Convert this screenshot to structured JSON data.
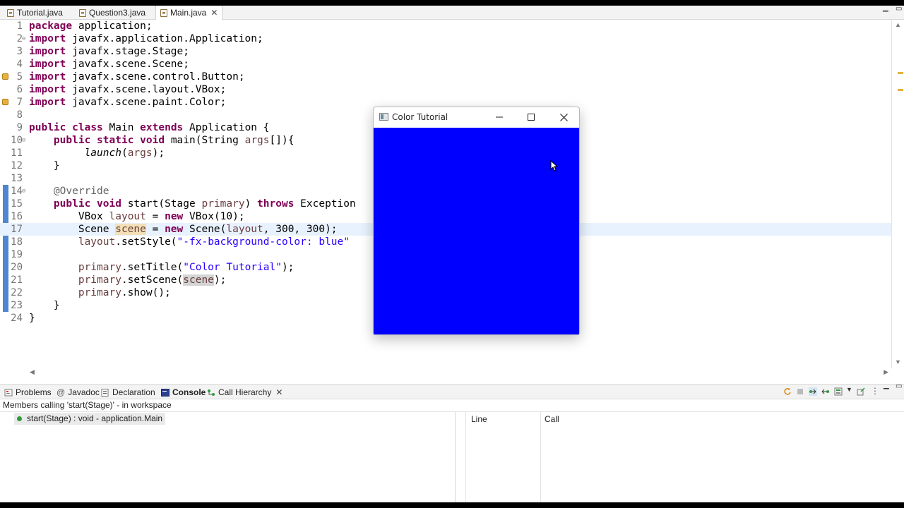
{
  "tabs": [
    {
      "label": "Tutorial.java",
      "active": false
    },
    {
      "label": "Question3.java",
      "active": false
    },
    {
      "label": "Main.java",
      "active": true
    }
  ],
  "editor": {
    "lines": [
      {
        "n": "1",
        "segs": [
          [
            "kw",
            "package"
          ],
          [
            "t",
            " application;"
          ]
        ]
      },
      {
        "n": "2",
        "fold": "⊖",
        "segs": [
          [
            "kw",
            "import"
          ],
          [
            "t",
            " javafx.application.Application;"
          ]
        ]
      },
      {
        "n": "3",
        "segs": [
          [
            "kw",
            "import"
          ],
          [
            "t",
            " javafx.stage.Stage;"
          ]
        ]
      },
      {
        "n": "4",
        "segs": [
          [
            "kw",
            "import"
          ],
          [
            "t",
            " javafx.scene.Scene;"
          ]
        ]
      },
      {
        "n": "5",
        "warn": true,
        "segs": [
          [
            "kw",
            "import"
          ],
          [
            "t",
            " javafx.scene.control.Button;"
          ]
        ]
      },
      {
        "n": "6",
        "segs": [
          [
            "kw",
            "import"
          ],
          [
            "t",
            " javafx.scene.layout.VBox;"
          ]
        ]
      },
      {
        "n": "7",
        "warn": true,
        "segs": [
          [
            "kw",
            "import"
          ],
          [
            "t",
            " javafx.scene.paint.Color;"
          ]
        ]
      },
      {
        "n": "8",
        "segs": []
      },
      {
        "n": "9",
        "segs": [
          [
            "kw",
            "public"
          ],
          [
            "t",
            " "
          ],
          [
            "kw",
            "class"
          ],
          [
            "t",
            " Main "
          ],
          [
            "kw",
            "extends"
          ],
          [
            "t",
            " Application {"
          ]
        ]
      },
      {
        "n": "10",
        "fold": "⊖",
        "segs": [
          [
            "t",
            "    "
          ],
          [
            "kw",
            "public"
          ],
          [
            "t",
            " "
          ],
          [
            "kw",
            "static"
          ],
          [
            "t",
            " "
          ],
          [
            "kw",
            "void"
          ],
          [
            "t",
            " main(String "
          ],
          [
            "local",
            "args"
          ],
          [
            "t",
            "[]){"
          ]
        ]
      },
      {
        "n": "11",
        "segs": [
          [
            "t",
            "         "
          ],
          [
            "ital",
            "launch"
          ],
          [
            "t",
            "("
          ],
          [
            "local",
            "args"
          ],
          [
            "t",
            ");"
          ]
        ]
      },
      {
        "n": "12",
        "segs": [
          [
            "t",
            "    }"
          ]
        ]
      },
      {
        "n": "13",
        "segs": []
      },
      {
        "n": "14",
        "fold": "⊖",
        "segs": [
          [
            "t",
            "    "
          ],
          [
            "ann",
            "@Override"
          ]
        ]
      },
      {
        "n": "15",
        "segs": [
          [
            "t",
            "    "
          ],
          [
            "kw",
            "public"
          ],
          [
            "t",
            " "
          ],
          [
            "kw",
            "void"
          ],
          [
            "t",
            " start(Stage "
          ],
          [
            "local",
            "primary"
          ],
          [
            "t",
            ") "
          ],
          [
            "kw",
            "throws"
          ],
          [
            "t",
            " Exception"
          ]
        ]
      },
      {
        "n": "16",
        "segs": [
          [
            "t",
            "        VBox "
          ],
          [
            "local",
            "layout"
          ],
          [
            "t",
            " = "
          ],
          [
            "kw",
            "new"
          ],
          [
            "t",
            " VBox(10);"
          ]
        ]
      },
      {
        "n": "17",
        "current": true,
        "segs": [
          [
            "t",
            "        Scene "
          ],
          [
            "occ",
            "scene"
          ],
          [
            "t",
            " = "
          ],
          [
            "kw",
            "new"
          ],
          [
            "t",
            " Scene("
          ],
          [
            "local",
            "layout"
          ],
          [
            "t",
            ", 300, 300);"
          ]
        ]
      },
      {
        "n": "18",
        "segs": [
          [
            "t",
            "        "
          ],
          [
            "local",
            "layout"
          ],
          [
            "t",
            ".setStyle("
          ],
          [
            "str",
            "\"-fx-background-color: blue\""
          ]
        ]
      },
      {
        "n": "19",
        "segs": []
      },
      {
        "n": "20",
        "segs": [
          [
            "t",
            "        "
          ],
          [
            "local",
            "primary"
          ],
          [
            "t",
            ".setTitle("
          ],
          [
            "str",
            "\"Color Tutorial\""
          ],
          [
            "t",
            ");"
          ]
        ]
      },
      {
        "n": "21",
        "segs": [
          [
            "t",
            "        "
          ],
          [
            "local",
            "primary"
          ],
          [
            "t",
            ".setScene("
          ],
          [
            "occ2",
            "scene"
          ],
          [
            "t",
            ");"
          ]
        ]
      },
      {
        "n": "22",
        "segs": [
          [
            "t",
            "        "
          ],
          [
            "local",
            "primary"
          ],
          [
            "t",
            ".show();"
          ]
        ]
      },
      {
        "n": "23",
        "segs": [
          [
            "t",
            "    }"
          ]
        ]
      },
      {
        "n": "24",
        "segs": [
          [
            "t",
            "}"
          ]
        ]
      }
    ]
  },
  "bottom_panel": {
    "tabs": [
      {
        "label": "Problems",
        "icon": "problems-icon"
      },
      {
        "label": "Javadoc",
        "icon": "javadoc-icon"
      },
      {
        "label": "Declaration",
        "icon": "declaration-icon"
      },
      {
        "label": "Console",
        "icon": "console-icon"
      },
      {
        "label": "Call Hierarchy",
        "icon": "call-hierarchy-icon"
      }
    ],
    "members_text": "Members calling 'start(Stage)' - in workspace",
    "tree_item": "start(Stage) : void - application.Main",
    "columns": [
      "Line",
      "Call"
    ]
  },
  "fx_window": {
    "title": "Color Tutorial",
    "background": "#0000ff"
  }
}
